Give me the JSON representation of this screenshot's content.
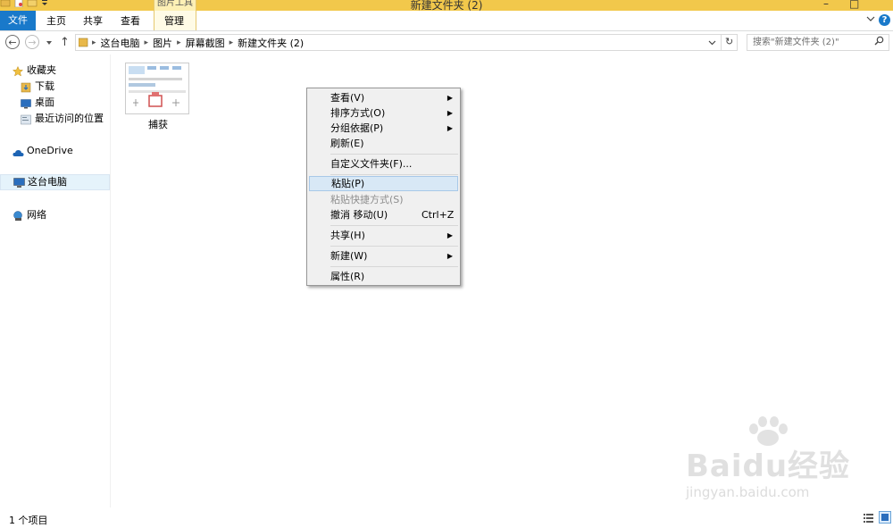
{
  "window": {
    "title": "新建文件夹 (2)",
    "context_tab_group": "图片工具",
    "accent": "#1979ca",
    "titlebar_color": "#f2c84b"
  },
  "ribbon": {
    "tabs": [
      {
        "label": "文件"
      },
      {
        "label": "主页"
      },
      {
        "label": "共享"
      },
      {
        "label": "查看"
      },
      {
        "label": "管理"
      }
    ],
    "help_label": "?"
  },
  "nav": {
    "breadcrumbs": [
      "这台电脑",
      "图片",
      "屏幕截图",
      "新建文件夹 (2)"
    ],
    "search_placeholder": "搜索\"新建文件夹 (2)\""
  },
  "sidebar": {
    "items": [
      {
        "label": "收藏夹",
        "icon": "star-icon"
      },
      {
        "label": "下载",
        "icon": "download-folder-icon"
      },
      {
        "label": "桌面",
        "icon": "desktop-icon"
      },
      {
        "label": "最近访问的位置",
        "icon": "recent-places-icon"
      },
      {
        "label": "OneDrive",
        "icon": "cloud-icon"
      },
      {
        "label": "这台电脑",
        "icon": "computer-icon"
      },
      {
        "label": "网络",
        "icon": "network-icon"
      }
    ]
  },
  "content": {
    "files": [
      {
        "name": "捕获",
        "icon": "image-thumbnail-icon"
      }
    ]
  },
  "context_menu": {
    "items": [
      {
        "label": "查看(V)",
        "submenu": true
      },
      {
        "label": "排序方式(O)",
        "submenu": true
      },
      {
        "label": "分组依据(P)",
        "submenu": true
      },
      {
        "label": "刷新(E)"
      },
      {
        "label": "自定义文件夹(F)..."
      },
      {
        "label": "粘贴(P)",
        "highlighted": true
      },
      {
        "label": "粘贴快捷方式(S)",
        "disabled": true
      },
      {
        "label": "撤消 移动(U)",
        "shortcut": "Ctrl+Z"
      },
      {
        "label": "共享(H)",
        "submenu": true
      },
      {
        "label": "新建(W)",
        "submenu": true
      },
      {
        "label": "属性(R)"
      }
    ]
  },
  "status": {
    "item_count": "1 个项目"
  },
  "watermark": {
    "main": "Baidu经验",
    "sub": "jingyan.baidu.com"
  }
}
